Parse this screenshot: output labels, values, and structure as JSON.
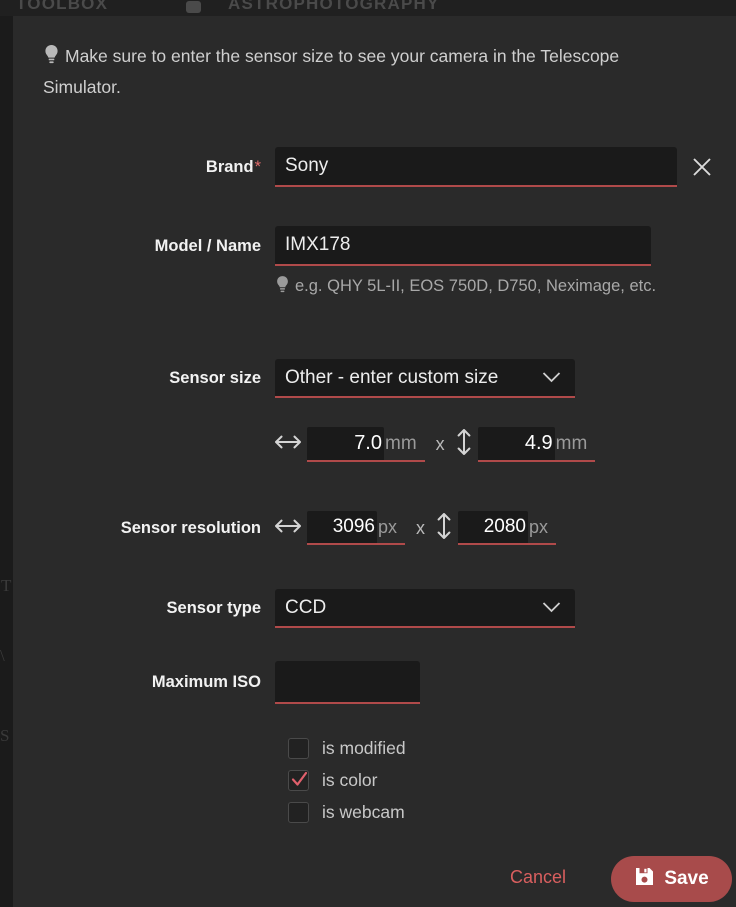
{
  "background": {
    "toolbox_label": "TOOLBOX",
    "astro_label": "ASTROPHOTOGRAPHY",
    "ghost_marks": [
      "T",
      "\\",
      "S"
    ]
  },
  "dialog": {
    "notice": "Make sure to enter the sensor size to see your camera in the Telescope Simulator.",
    "notice_icon": "lightbulb-icon",
    "fields": {
      "brand": {
        "label": "Brand",
        "required_marker": "*",
        "value": "Sony",
        "clear_icon": "close-icon"
      },
      "model": {
        "label": "Model / Name",
        "value": "IMX178",
        "hint": "e.g. QHY 5L-II, EOS 750D, D750, Neximage, etc.",
        "hint_icon": "lightbulb-icon"
      },
      "sensor_size": {
        "label": "Sensor size",
        "selected": "Other - enter custom size",
        "options": [
          "Other - enter custom size"
        ],
        "chevron_icon": "chevron-down-icon",
        "width": {
          "value": "7.0",
          "unit": "mm",
          "icon": "arrow-horizontal-icon"
        },
        "height": {
          "value": "4.9",
          "unit": "mm",
          "icon": "arrow-vertical-icon"
        },
        "separator": "x"
      },
      "sensor_resolution": {
        "label": "Sensor resolution",
        "width": {
          "value": "3096",
          "unit": "px",
          "icon": "arrow-horizontal-icon"
        },
        "height": {
          "value": "2080",
          "unit": "px",
          "icon": "arrow-vertical-icon"
        },
        "separator": "x"
      },
      "sensor_type": {
        "label": "Sensor type",
        "selected": "CCD",
        "options": [
          "CCD"
        ],
        "chevron_icon": "chevron-down-icon"
      },
      "maximum_iso": {
        "label": "Maximum ISO",
        "value": "",
        "placeholder": ""
      }
    },
    "checkboxes": [
      {
        "label": "is modified",
        "checked": false
      },
      {
        "label": "is color",
        "checked": true
      },
      {
        "label": "is webcam",
        "checked": false
      }
    ],
    "footer": {
      "cancel_label": "Cancel",
      "save_label": "Save",
      "save_icon": "save-floppy-icon"
    }
  },
  "colors": {
    "dialog_bg": "#2a2a2a",
    "page_bg": "#1c1c1c",
    "input_bg": "#1a1a1a",
    "accent_underline": "#b04a4a",
    "accent_button": "#a84b4b",
    "cancel_text": "#d95f5f",
    "required_star": "#e06c6c",
    "label_text": "#f2f2f2",
    "body_text": "#cfcfcf"
  }
}
